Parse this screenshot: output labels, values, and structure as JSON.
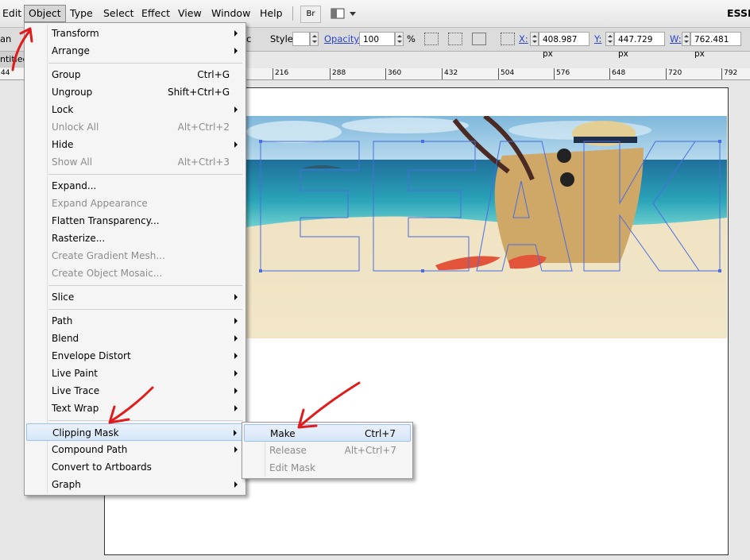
{
  "menubar": {
    "items": [
      "Edit",
      "Object",
      "Type",
      "Select",
      "Effect",
      "View",
      "Window",
      "Help"
    ],
    "bridge_label": "Br",
    "workspace_label": "ESSE"
  },
  "controlbar": {
    "left_partial": "c",
    "style_label": "Style:",
    "opacity_label": "Opacity:",
    "opacity_value": "100",
    "percent": "%",
    "x_label": "X:",
    "x_value": "408.987 px",
    "y_label": "Y:",
    "y_value": "447.729 px",
    "w_label": "W:",
    "w_value": "762.481 px"
  },
  "doc_tab": {
    "label": "ntitled",
    "left_partial": "an"
  },
  "ruler": {
    "ticks": [
      "44",
      "216",
      "288",
      "360",
      "432",
      "504",
      "576",
      "648",
      "720",
      "792"
    ]
  },
  "object_menu": {
    "items": [
      {
        "label": "Transform",
        "shortcut": "",
        "submenu": true,
        "disabled": false
      },
      {
        "label": "Arrange",
        "shortcut": "",
        "submenu": true,
        "disabled": false
      },
      {
        "label": "Group",
        "shortcut": "Ctrl+G",
        "submenu": false,
        "disabled": false
      },
      {
        "label": "Ungroup",
        "shortcut": "Shift+Ctrl+G",
        "submenu": false,
        "disabled": false
      },
      {
        "label": "Lock",
        "shortcut": "",
        "submenu": true,
        "disabled": false
      },
      {
        "label": "Unlock All",
        "shortcut": "Alt+Ctrl+2",
        "submenu": false,
        "disabled": true
      },
      {
        "label": "Hide",
        "shortcut": "",
        "submenu": true,
        "disabled": false
      },
      {
        "label": "Show All",
        "shortcut": "Alt+Ctrl+3",
        "submenu": false,
        "disabled": true
      },
      {
        "label": "Expand...",
        "shortcut": "",
        "submenu": false,
        "disabled": false
      },
      {
        "label": "Expand Appearance",
        "shortcut": "",
        "submenu": false,
        "disabled": true
      },
      {
        "label": "Flatten Transparency...",
        "shortcut": "",
        "submenu": false,
        "disabled": false
      },
      {
        "label": "Rasterize...",
        "shortcut": "",
        "submenu": false,
        "disabled": false
      },
      {
        "label": "Create Gradient Mesh...",
        "shortcut": "",
        "submenu": false,
        "disabled": true
      },
      {
        "label": "Create Object Mosaic...",
        "shortcut": "",
        "submenu": false,
        "disabled": true
      },
      {
        "label": "Slice",
        "shortcut": "",
        "submenu": true,
        "disabled": false
      },
      {
        "label": "Path",
        "shortcut": "",
        "submenu": true,
        "disabled": false
      },
      {
        "label": "Blend",
        "shortcut": "",
        "submenu": true,
        "disabled": false
      },
      {
        "label": "Envelope Distort",
        "shortcut": "",
        "submenu": true,
        "disabled": false
      },
      {
        "label": "Live Paint",
        "shortcut": "",
        "submenu": true,
        "disabled": false
      },
      {
        "label": "Live Trace",
        "shortcut": "",
        "submenu": true,
        "disabled": false
      },
      {
        "label": "Text Wrap",
        "shortcut": "",
        "submenu": true,
        "disabled": false
      },
      {
        "label": "Clipping Mask",
        "shortcut": "",
        "submenu": true,
        "disabled": false
      },
      {
        "label": "Compound Path",
        "shortcut": "",
        "submenu": true,
        "disabled": false
      },
      {
        "label": "Convert to Artboards",
        "shortcut": "",
        "submenu": false,
        "disabled": false
      },
      {
        "label": "Graph",
        "shortcut": "",
        "submenu": true,
        "disabled": false
      }
    ]
  },
  "clipping_submenu": {
    "items": [
      {
        "label": "Make",
        "shortcut": "Ctrl+7",
        "disabled": false
      },
      {
        "label": "Release",
        "shortcut": "Alt+Ctrl+7",
        "disabled": true
      },
      {
        "label": "Edit Mask",
        "shortcut": "",
        "disabled": true
      }
    ]
  },
  "colors": {
    "highlight": "#d6e6f8",
    "selection_path": "#4a6de0",
    "annotation_arrow": "#e01b1b"
  }
}
